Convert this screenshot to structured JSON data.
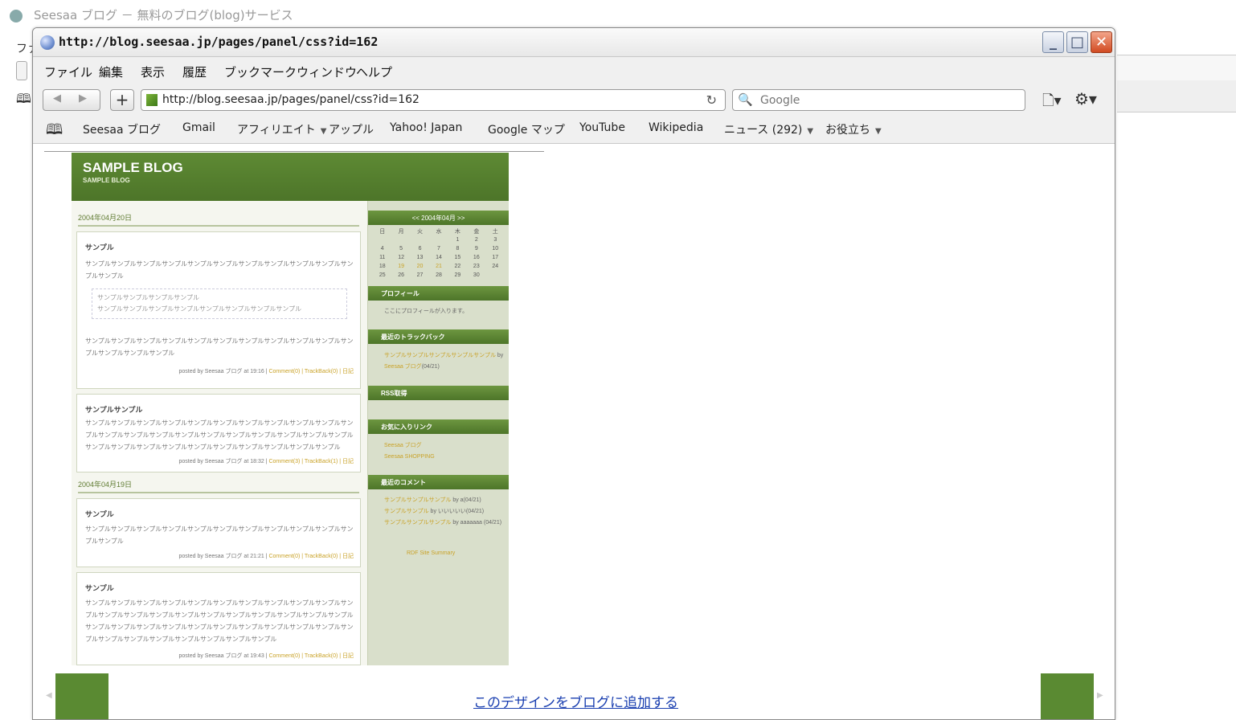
{
  "background_window": {
    "title": "Seesaa ブログ － 無料のブログ(blog)サービス",
    "menu_partial": "ファ",
    "bookmark_icon": "open-book-icon"
  },
  "popup": {
    "title": "http://blog.seesaa.jp/pages/panel/css?id=162",
    "window_buttons": [
      "minimize-icon",
      "maximize-icon",
      "close-icon"
    ],
    "menu": [
      "ファイル",
      "編集",
      "表示",
      "履歴",
      "ブックマーク",
      "ウィンドウ",
      "ヘルプ"
    ],
    "nav": {
      "back": "◀",
      "forward": "▶",
      "new_tab": "+",
      "url": "http://blog.seesaa.jp/pages/panel/css?id=162",
      "search_placeholder": "Google"
    },
    "bookmarks": [
      {
        "label": "Seesaa ブログ",
        "dropdown": false
      },
      {
        "label": "Gmail",
        "dropdown": false
      },
      {
        "label": "アフィリエイト",
        "dropdown": true
      },
      {
        "label": "アップル",
        "dropdown": false
      },
      {
        "label": "Yahoo! Japan",
        "dropdown": false
      },
      {
        "label": "Google マップ",
        "dropdown": false
      },
      {
        "label": "YouTube",
        "dropdown": false
      },
      {
        "label": "Wikipedia",
        "dropdown": false
      },
      {
        "label": "ニュース (292)",
        "dropdown": true
      },
      {
        "label": "お役立ち",
        "dropdown": true
      }
    ]
  },
  "blog": {
    "title": "SAMPLE BLOG",
    "subtitle": "SAMPLE BLOG",
    "dates": [
      "2004年04月20日",
      "2004年04月19日"
    ],
    "posts": [
      {
        "title": "サンプル",
        "body": "サンプルサンプルサンプルサンプルサンプルサンプルサンプルサンプルサンプルサンプルサンプルサンプル",
        "quote_lines": [
          "サンプルサンプルサンプルサンプル",
          "サンプルサンプルサンプルサンプルサンプルサンプルサンプルサンプル"
        ],
        "body2": "サンプルサンプルサンプルサンプルサンプルサンプルサンプルサンプルサンプルサンプルサンプルサンプルサンプルサンプル",
        "footer_prefix": "posted by Seesaa ブログ at 19:16 |",
        "footer_links": "Comment(0) | TrackBack(0) | 日記"
      },
      {
        "title": "サンプルサンプル",
        "body": "サンプルサンプルサンプルサンプルサンプルサンプルサンプルサンプルサンプルサンプルサンプルサンプルサンプルサンプルサンプルサンプルサンプルサンプルサンプルサンプルサンプルサンプルサンプルサンプルサンプルサンプルサンプルサンプルサンプルサンプルサンプル",
        "footer_prefix": "posted by Seesaa ブログ at 18:32 |",
        "footer_links": "Comment(3) | TrackBack(1) | 日記"
      },
      {
        "title": "サンプル",
        "body": "サンプルサンプルサンプルサンプルサンプルサンプルサンプルサンプルサンプルサンプルサンプルサンプル",
        "footer_prefix": "posted by Seesaa ブログ at 21:21 |",
        "footer_links": "Comment(0) | TrackBack(0) | 日記"
      },
      {
        "title": "サンプル",
        "body": "サンプルサンプルサンプルサンプルサンプルサンプルサンプルサンプルサンプルサンプルサンプルサンプルサンプルサンプルサンプルサンプルサンプルサンプルサンプルサンプルサンプルサンプルサンプルサンプルサンプルサンプルサンプルサンプルサンプルサンプルサンプルサンプルサンプルサンプルサンプルサンプルサンプルサンプルサンプル",
        "footer_prefix": "posted by Seesaa ブログ at 19:43 |",
        "footer_links": "Comment(0) | TrackBack(0) | 日記"
      }
    ],
    "calendar": {
      "header": "<< 2004年04月 >>",
      "weekdays": [
        "日",
        "月",
        "火",
        "水",
        "木",
        "金",
        "土"
      ],
      "weeks": [
        [
          "",
          "",
          "",
          "",
          "1",
          "2",
          "3"
        ],
        [
          "4",
          "5",
          "6",
          "7",
          "8",
          "9",
          "10"
        ],
        [
          "11",
          "12",
          "13",
          "14",
          "15",
          "16",
          "17"
        ],
        [
          "18",
          "19",
          "20",
          "21",
          "22",
          "23",
          "24"
        ],
        [
          "25",
          "26",
          "27",
          "28",
          "29",
          "30",
          ""
        ]
      ],
      "linked_days": [
        "19",
        "20",
        "21"
      ]
    },
    "sidebar": {
      "profile_title": "プロフィール",
      "profile_text": "ここにプロフィールが入ります。",
      "trackback_title": "最近のトラックバック",
      "trackback_link": "サンプルサンプルサンプルサンプルサンプル",
      "trackback_by": "by",
      "trackback_author": "Seesaa ブログ",
      "trackback_date": "(04/21)",
      "rss_title": "RSS取得",
      "favorites_title": "お気に入りリンク",
      "favorite_links": [
        "Seesaa ブログ",
        "Seesaa SHOPPING"
      ],
      "comments_title": "最近のコメント",
      "comments": [
        {
          "link": "サンプルサンプルサンプル",
          "by": "by a(04/21)"
        },
        {
          "link": "サンプルサンプル",
          "by": "by いいいいい(04/21)"
        },
        {
          "link": "サンプルサンプルサンプル",
          "by": "by aaaaaaa (04/21)"
        }
      ],
      "rdf_link": "RDF Site Summary"
    }
  },
  "footer": {
    "add_design_link": "このデザインをブログに追加する"
  },
  "colors": {
    "blog_green": "#5a8a32",
    "link_yellow": "#c9a227",
    "link_blue": "#1a3fb0"
  }
}
